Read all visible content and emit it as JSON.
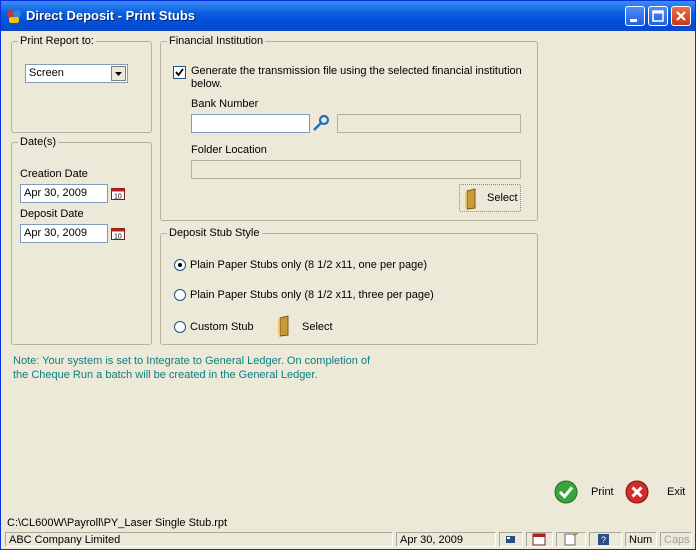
{
  "window": {
    "title": "Direct Deposit - Print Stubs"
  },
  "print_report": {
    "legend": "Print Report to:",
    "selected": "Screen"
  },
  "dates": {
    "legend": "Date(s)",
    "creation_label": "Creation Date",
    "creation_value": "Apr 30, 2009",
    "deposit_label": "Deposit Date",
    "deposit_value": "Apr 30, 2009"
  },
  "financial": {
    "legend": "Financial Institution",
    "generate_label_line1": "Generate the transmission file using the selected financial institution",
    "generate_label_line2": "below.",
    "generate_checked": true,
    "bank_number_label": "Bank Number",
    "bank_number_value": "",
    "bank_name_value": "",
    "folder_label": "Folder Location",
    "folder_value": "",
    "select_label": "Select"
  },
  "stub_style": {
    "legend": "Deposit Stub Style",
    "options": [
      {
        "label": "Plain Paper Stubs only (8 1/2 x11, one per page)",
        "selected": true
      },
      {
        "label": "Plain Paper Stubs only (8 1/2 x11, three per page)",
        "selected": false
      },
      {
        "label": "Custom Stub",
        "selected": false
      }
    ],
    "select_label": "Select"
  },
  "note": {
    "line1": "Note:  Your system is set to Integrate to General Ledger.  On completion of",
    "line2": "the Cheque Run a batch will be created in the General Ledger."
  },
  "actions": {
    "print_label": "Print",
    "exit_label": "Exit"
  },
  "status": {
    "path": "C:\\CL600W\\Payroll\\PY_Laser Single Stub.rpt",
    "company": "ABC Company Limited",
    "date": "Apr 30, 2009",
    "num": "Num",
    "caps": "Caps"
  },
  "colors": {
    "title_bar": "#0a5fe0",
    "note_text": "#0a7f82",
    "window_bg": "#ece9d8"
  }
}
